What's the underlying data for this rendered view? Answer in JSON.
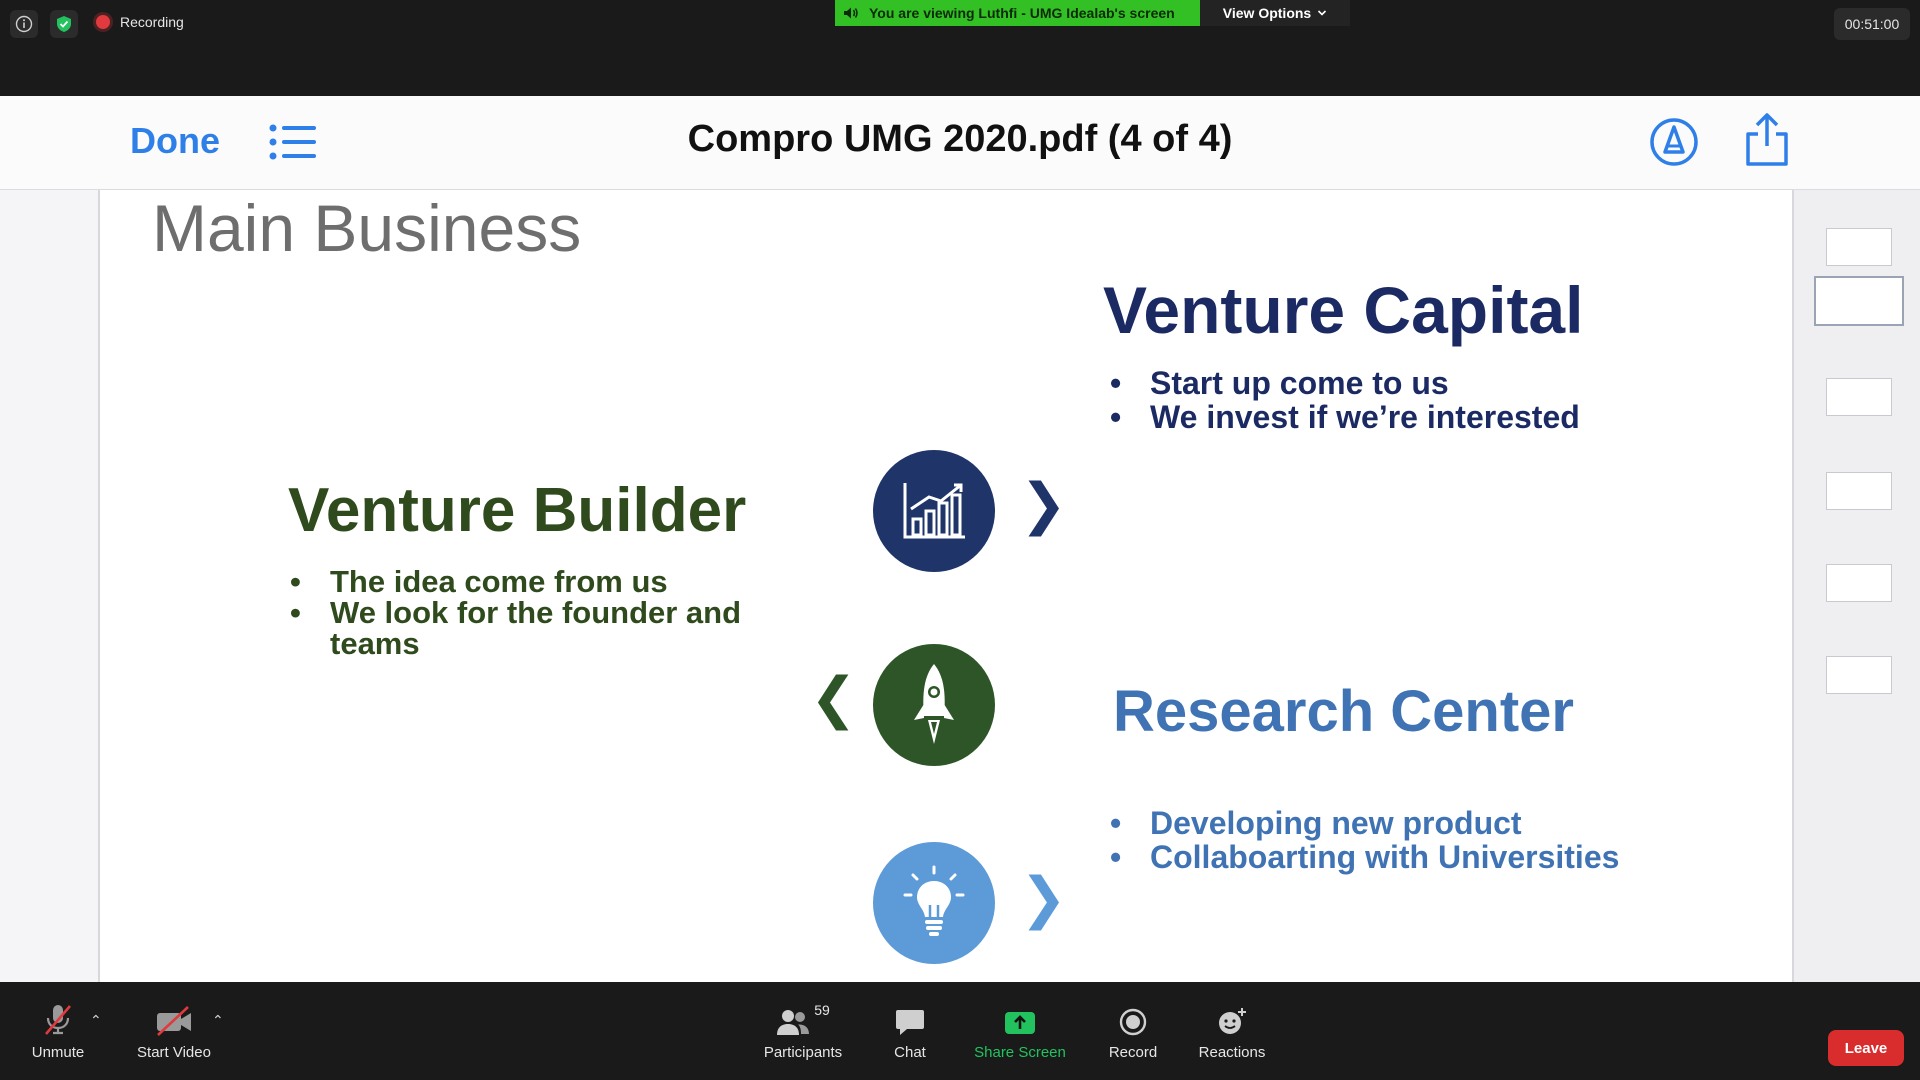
{
  "topbar": {
    "recording_label": "Recording",
    "viewing_banner": "You are viewing Luthfi - UMG Idealab's screen",
    "view_options_label": "View Options",
    "timer": "00:51:00"
  },
  "viewer": {
    "done_label": "Done",
    "title": "Compro UMG 2020.pdf (4 of 4)"
  },
  "slide": {
    "title": "Main Business",
    "venture_capital": {
      "title": "Venture Capital",
      "bullets": [
        "Start up come to us",
        "We invest if we’re interested"
      ]
    },
    "venture_builder": {
      "title": "Venture Builder",
      "bullets": [
        "The idea come from us",
        "We look for the founder and teams"
      ]
    },
    "research_center": {
      "title": "Research Center",
      "bullets": [
        "Developing new product",
        "Collaboarting with Universities"
      ]
    }
  },
  "toolbar": {
    "unmute_label": "Unmute",
    "start_video_label": "Start Video",
    "participants_label": "Participants",
    "participants_count": "59",
    "chat_label": "Chat",
    "share_screen_label": "Share Screen",
    "record_label": "Record",
    "reactions_label": "Reactions",
    "leave_label": "Leave"
  },
  "colors": {
    "viewing_banner": "#32c024",
    "share_screen": "#22c35e",
    "leave": "#d92d2d",
    "venture_capital": "#1b2a63",
    "venture_builder": "#2f4a1c",
    "research_center": "#3f73b4",
    "ios_blue": "#2f7fe8"
  }
}
